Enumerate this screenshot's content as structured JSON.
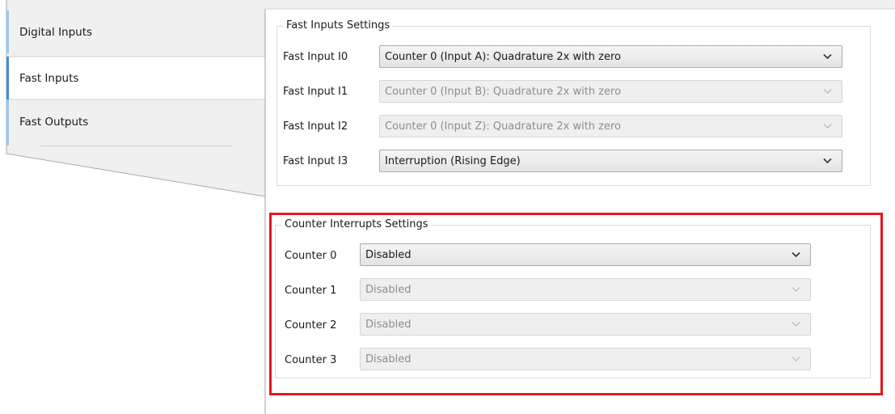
{
  "nav": {
    "items": [
      {
        "label": "Digital Inputs",
        "selected": false
      },
      {
        "label": "Fast Inputs",
        "selected": true
      },
      {
        "label": "Fast Outputs",
        "selected": false
      }
    ],
    "accent_color": "#3c8fd9"
  },
  "fast_inputs": {
    "title": "Fast Inputs Settings",
    "rows": [
      {
        "label": "Fast Input I0",
        "value": "Counter 0 (Input A): Quadrature 2x with zero",
        "enabled": true
      },
      {
        "label": "Fast Input I1",
        "value": "Counter 0 (Input B): Quadrature 2x with zero",
        "enabled": false
      },
      {
        "label": "Fast Input I2",
        "value": "Counter 0 (Input Z): Quadrature 2x with zero",
        "enabled": false
      },
      {
        "label": "Fast Input I3",
        "value": "Interruption (Rising Edge)",
        "enabled": true
      }
    ]
  },
  "counter_interrupts": {
    "title": "Counter Interrupts Settings",
    "rows": [
      {
        "label": "Counter 0",
        "value": "Disabled",
        "enabled": true
      },
      {
        "label": "Counter 1",
        "value": "Disabled",
        "enabled": false
      },
      {
        "label": "Counter 2",
        "value": "Disabled",
        "enabled": false
      },
      {
        "label": "Counter 3",
        "value": "Disabled",
        "enabled": false
      }
    ],
    "highlight_color": "#e8141e"
  }
}
